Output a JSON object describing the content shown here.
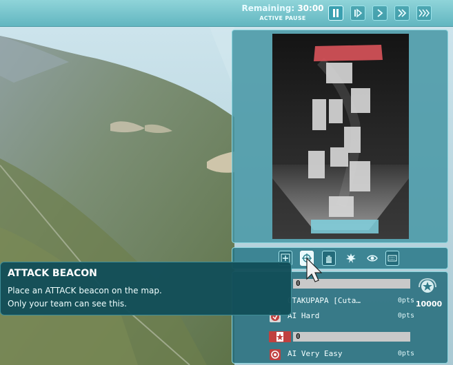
{
  "colors": {
    "accent": "#62b6c0",
    "panel": "#2f7a88",
    "enemy_team": "#c0413f",
    "text": "#ffffff"
  },
  "hud": {
    "remaining_label": "Remaining:",
    "remaining_time": "30:00",
    "pause_state": "ACTIVE PAUSE",
    "controls": [
      {
        "name": "pause",
        "icon": "pause-icon",
        "active": true
      },
      {
        "name": "step",
        "icon": "step-icon",
        "active": false
      },
      {
        "name": "play",
        "icon": "play-icon",
        "active": false
      },
      {
        "name": "fast-forward",
        "icon": "fast-forward-icon",
        "active": false
      },
      {
        "name": "fastest",
        "icon": "fastest-icon",
        "active": false
      }
    ]
  },
  "command_bar": {
    "buttons": [
      {
        "name": "help-beacon",
        "icon": "cross-beacon-icon",
        "active": false
      },
      {
        "name": "attack-beacon",
        "icon": "crosshair-beacon-icon",
        "active": true
      },
      {
        "name": "defend-beacon",
        "icon": "hand-icon",
        "active": false
      },
      {
        "name": "explosion",
        "icon": "explosion-icon",
        "active": false
      },
      {
        "name": "visibility",
        "icon": "eye-icon",
        "active": false
      },
      {
        "name": "keyboard",
        "icon": "keyboard-icon",
        "active": false
      }
    ]
  },
  "tooltip": {
    "title": "ATTACK BEACON",
    "line1": "Place an ATTACK beacon on the map.",
    "line2": "Only your team can see this."
  },
  "scoreboard": {
    "teams": [
      {
        "score": "0",
        "color": "#2f7a88",
        "players": [
          {
            "name": "OTAKUPAPA [Cuta…",
            "pts": "0pts",
            "icon_color": "#2f7a88"
          },
          {
            "name": "AI Hard",
            "pts": "0pts",
            "icon_color": "#c0413f"
          }
        ]
      },
      {
        "score": "0",
        "color": "#c0413f",
        "players": [
          {
            "name": "AI Very Easy",
            "pts": "0pts",
            "icon_color": "#c0413f"
          }
        ]
      }
    ],
    "total_score": "10000"
  }
}
